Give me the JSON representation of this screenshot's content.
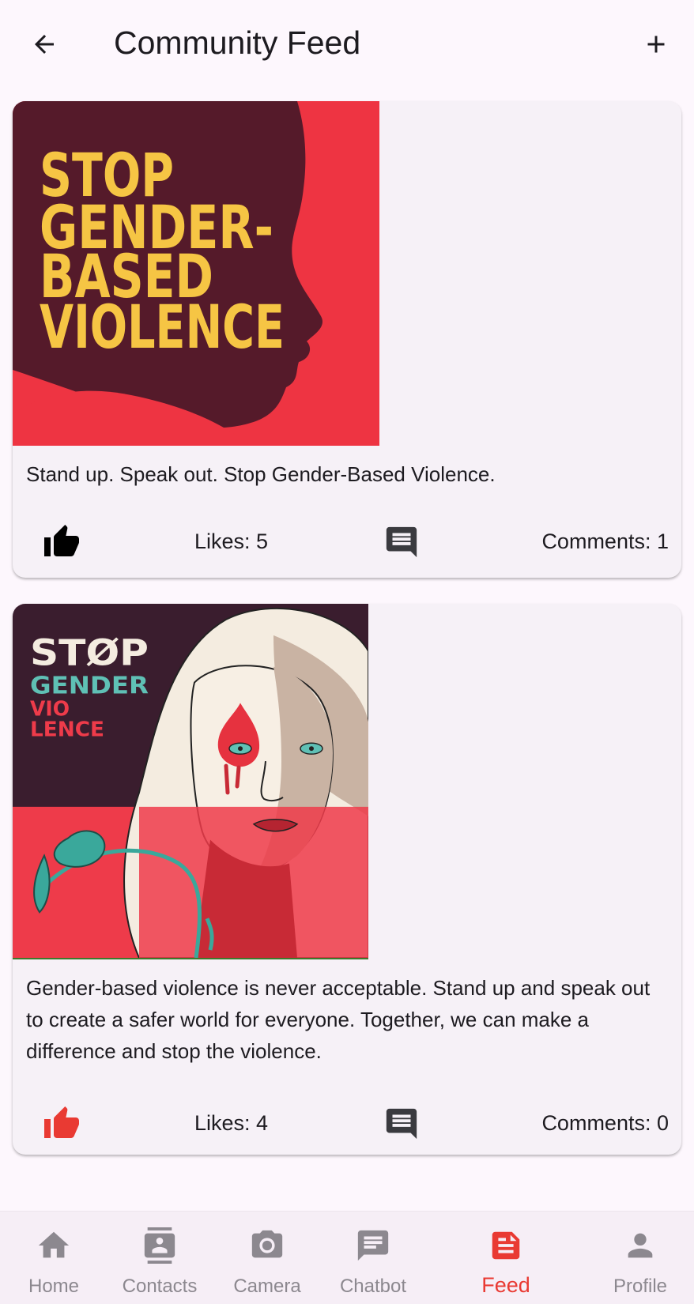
{
  "header": {
    "title": "Community Feed",
    "back_icon": "arrow-back-icon",
    "add_icon": "plus-icon"
  },
  "posts": [
    {
      "image_text": [
        "STOP",
        "GENDER-",
        "BASED",
        "VIOLENCE"
      ],
      "caption": "Stand up. Speak out. Stop Gender-Based Violence.",
      "likes_label": "Likes: 5",
      "comments_label": "Comments: 1",
      "liked": false,
      "like_color": "#000000"
    },
    {
      "image_text": [
        "STØP",
        "GENDER",
        "VIO",
        "LENCE"
      ],
      "caption": "Gender-based violence is never acceptable. Stand up and speak out to create a safer world for everyone. Together, we can make a difference and stop the violence.",
      "likes_label": "Likes: 4",
      "comments_label": "Comments: 0",
      "liked": true,
      "like_color": "#e93a33"
    }
  ],
  "nav": {
    "items": [
      {
        "label": "Home",
        "icon": "home-icon"
      },
      {
        "label": "Contacts",
        "icon": "contacts-icon"
      },
      {
        "label": "Camera",
        "icon": "camera-icon"
      },
      {
        "label": "Chatbot",
        "icon": "chat-icon"
      },
      {
        "label": "Feed",
        "icon": "feed-icon"
      },
      {
        "label": "Profile",
        "icon": "person-icon"
      }
    ],
    "active": "Feed",
    "active_color": "#e93a33",
    "inactive_color": "#8c888f"
  }
}
